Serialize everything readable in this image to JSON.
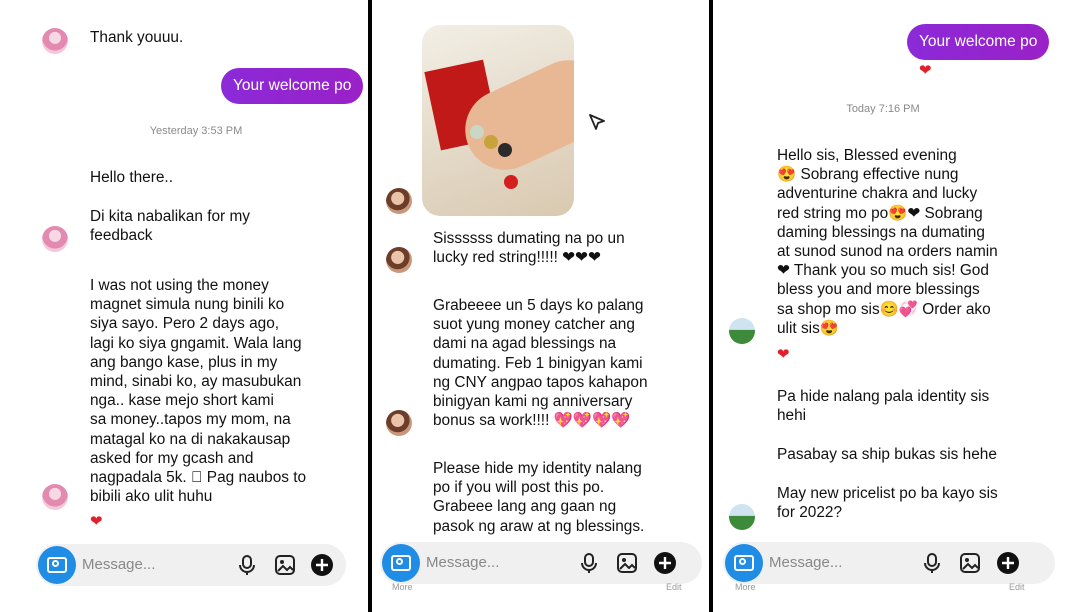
{
  "panel1": {
    "top_message": "Thank youuu.",
    "sent_message": "Your welcome po",
    "timestamp": "Yesterday 3:53 PM",
    "msg_hello": "Hello there..",
    "msg_feedback": "Di kita nabalikan for my\nfeedback",
    "msg_long": "I was not using the money\nmagnet simula nung binili ko\nsiya sayo. Pero 2 days ago,\nlagi ko siya gngamit. Wala lang\nang bango kase, plus in my\nmind, sinabi ko, ay masubukan\nnga.. kase mejo short kami\nsa money..tapos my mom, na\nmatagal ko na di nakakausap\nasked for my gcash and\nnagpadala 5k. \u0000 Pag naubos to\nbibili ako ulit huhu",
    "heart": "❤",
    "composer_placeholder": "Message..."
  },
  "panel2": {
    "msg_arrived": "Sissssss dumating na po un\nlucky red string!!!!! ❤❤❤",
    "msg_grabe": "Grabeeee un 5 days ko palang\nsuot yung money catcher ang\ndami na agad blessings na\ndumating. Feb 1 binigyan kami\nng CNY angpao tapos kahapon\nbinigyan kami ng anniversary\nbonus sa work!!!! 💖💖💖💖",
    "msg_hide": "Please hide my identity nalang\npo if you will post this po.\nGrabeee lang ang gaan ng\npasok ng araw at ng blessings.",
    "composer_placeholder": "Message...",
    "more_label": "More",
    "edit_label": "Edit"
  },
  "panel3": {
    "sent_message": "Your welcome po",
    "heart": "❤",
    "timestamp": "Today 7:16 PM",
    "msg_main": "Hello sis, Blessed evening\n😍 Sobrang effective nung\nadventurine chakra and lucky\nred string mo po😍❤ Sobrang\ndaming blessings na dumating\nat sunod sunod na orders namin\n❤ Thank you so much sis! God\nbless you and more blessings\nsa shop mo sis😊💞 Order ako\nulit sis😍",
    "heart2": "❤",
    "msg_hide": "Pa hide nalang pala identity sis\nhehi",
    "msg_ship": "Pasabay sa ship bukas sis hehe",
    "msg_pricelist": "May new pricelist po ba kayo sis\nfor 2022?",
    "composer_placeholder": "Message...",
    "more_label": "More",
    "edit_label": "Edit"
  },
  "colors": {
    "sent_bubble": "#9a21c7",
    "camera_button": "#1f8ce6",
    "heart": "#e0202a"
  }
}
